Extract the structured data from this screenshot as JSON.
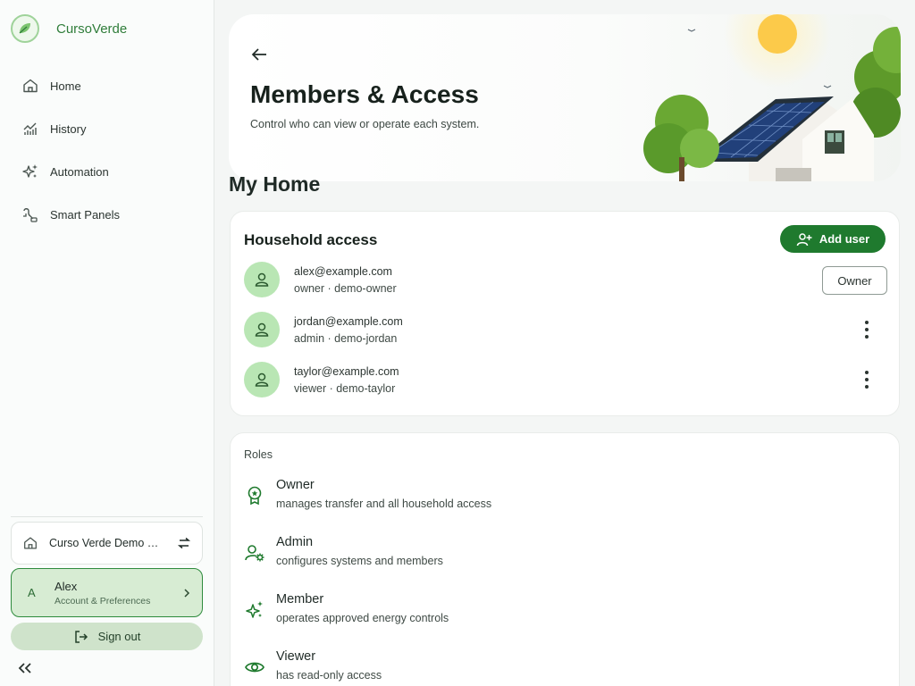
{
  "app": {
    "name": "CursoVerde"
  },
  "sidebar": {
    "items": [
      {
        "label": "Home",
        "icon": "home-icon"
      },
      {
        "label": "History",
        "icon": "chart-icon"
      },
      {
        "label": "Automation",
        "icon": "sparkle-icon"
      },
      {
        "label": "Smart Panels",
        "icon": "panel-icon"
      }
    ],
    "home_selector": "Curso Verde Demo Ho...",
    "account": {
      "avatar_letter": "A",
      "name": "Alex",
      "subtitle": "Account & Preferences"
    },
    "sign_out_label": "Sign out"
  },
  "header": {
    "title": "Members & Access",
    "subtitle": "Control who can view or operate each system."
  },
  "home_name": "My Home",
  "household": {
    "title": "Household access",
    "add_user_label": "Add user",
    "members": [
      {
        "email": "alex@example.com",
        "role_line": "owner · demo-owner",
        "action": "Owner"
      },
      {
        "email": "jordan@example.com",
        "role_line": "admin · demo-jordan",
        "action": "menu"
      },
      {
        "email": "taylor@example.com",
        "role_line": "viewer · demo-taylor",
        "action": "menu"
      }
    ]
  },
  "roles": {
    "label": "Roles",
    "items": [
      {
        "name": "Owner",
        "description": "manages transfer and all household access",
        "icon": "badge-icon"
      },
      {
        "name": "Admin",
        "description": "configures systems and members",
        "icon": "user-gear-icon"
      },
      {
        "name": "Member",
        "description": "operates approved energy controls",
        "icon": "sparkle-icon"
      },
      {
        "name": "Viewer",
        "description": "has read-only access",
        "icon": "eye-icon"
      }
    ]
  },
  "colors": {
    "brand": "#2f7d3a",
    "primary_button": "#1f7a2e",
    "avatar_bg": "#b9e6b4",
    "account_bg": "#d7ecd3"
  }
}
